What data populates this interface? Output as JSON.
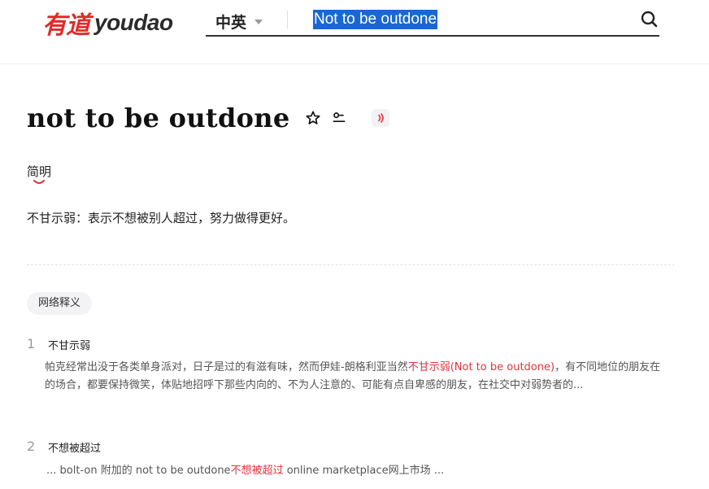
{
  "header": {
    "logo_cn": "有道",
    "logo_en": "youdao",
    "lang_select": "中英",
    "search_value": "Not to be outdone"
  },
  "entry": {
    "headword": "not to be outdone",
    "simple_label": "简明",
    "definition": "不甘示弱：表示不想被别人超过，努力做得更好。"
  },
  "web_section": {
    "tag_label": "网络释义",
    "items": [
      {
        "num": "1",
        "title": "不甘示弱",
        "text_before": "帕克经常出没于各类单身派对，日子是过的有滋有味，然而伊娃-朗格利亚当然",
        "highlight": "不甘示弱(Not to be outdone)",
        "text_after": "，有不同地位的朋友在的场合，都要保持微笑，体贴地招呼下那些内向的、不为人注意的、可能有点自卑感的朋友，在社交中对弱势者的..."
      },
      {
        "num": "2",
        "title": "不想被超过",
        "text_before": "... bolt-on 附加的 not to be outdone",
        "highlight": "不想被超过",
        "text_after": " online marketplace网上市场 ..."
      }
    ]
  },
  "colors": {
    "brand_red": "#e02b2b",
    "highlight_red": "#e0343c",
    "selection_blue": "#1a67d2"
  },
  "icons": [
    "search-icon",
    "star-icon",
    "word-list-icon",
    "speaker-icon"
  ]
}
